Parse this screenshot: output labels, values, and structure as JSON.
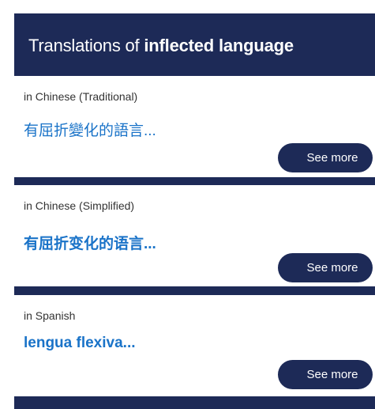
{
  "panel": {
    "title_prefix": "Translations of ",
    "title_bold": "inflected language"
  },
  "cards": [
    {
      "language": "in Chinese (Traditional)",
      "word": "有屈折變化的語言...",
      "button": "See more"
    },
    {
      "language": "in Chinese (Simplified)",
      "word": "有屈折变化的语言...",
      "button": "See more"
    },
    {
      "language": "in Spanish",
      "word": "lengua flexiva...",
      "button": "See more"
    }
  ],
  "colors": {
    "panel_background": "#1d2a57",
    "link": "#1a73c8",
    "button_background": "#1d2a57"
  }
}
